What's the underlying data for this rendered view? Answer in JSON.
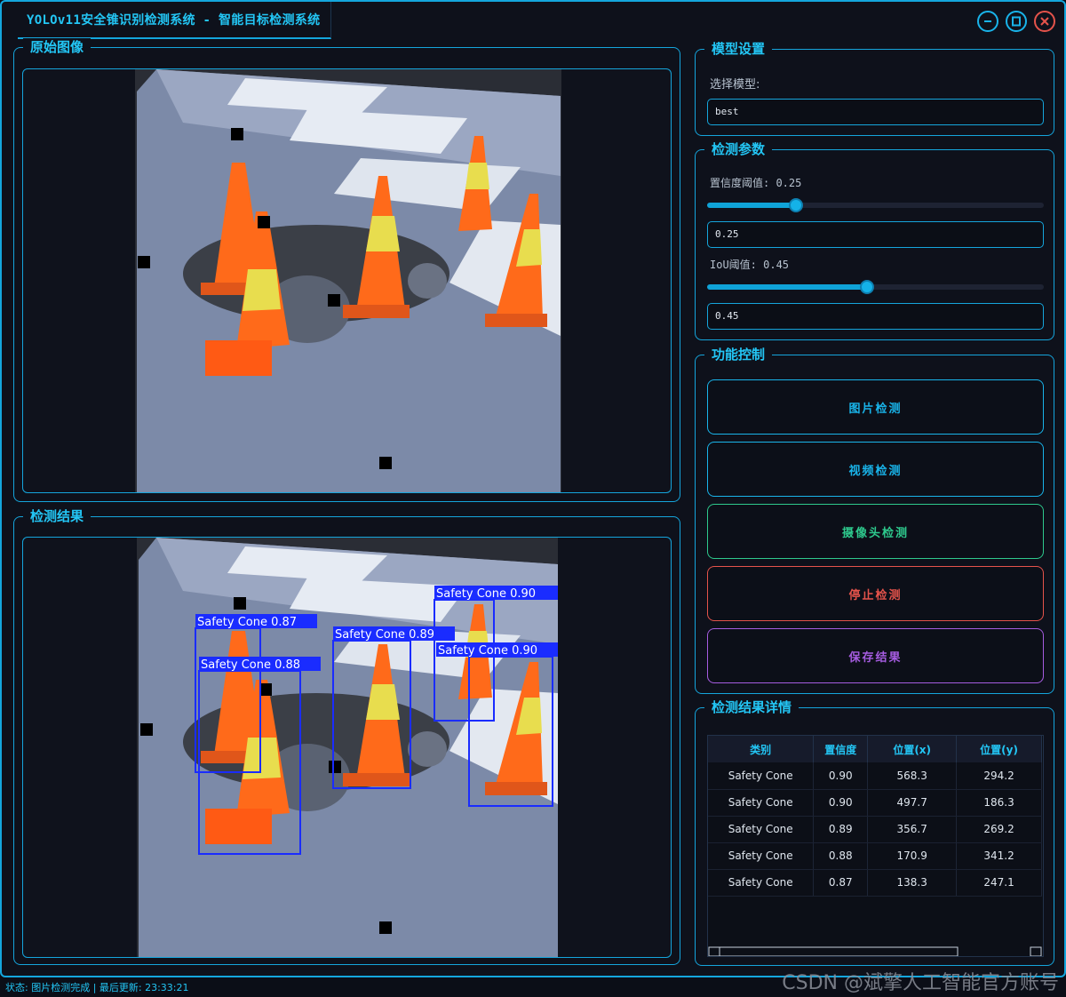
{
  "window": {
    "title": "YOLOv11安全锥识别检测系统 - 智能目标检测系统"
  },
  "panels": {
    "original_title": "原始图像",
    "result_title": "检测结果"
  },
  "model_settings": {
    "title": "模型设置",
    "select_label": "选择模型:",
    "model_value": "best"
  },
  "detect_params": {
    "title": "检测参数",
    "conf_label": "置信度阈值: 0.25",
    "conf_value": "0.25",
    "conf_level": 0.25,
    "iou_label": "IoU阈值: 0.45",
    "iou_value": "0.45",
    "iou_level": 0.45
  },
  "controls": {
    "title": "功能控制",
    "buttons": [
      {
        "label": "图片检测",
        "color": "#19b4ea"
      },
      {
        "label": "视频检测",
        "color": "#19b4ea"
      },
      {
        "label": "摄像头检测",
        "color": "#2ec98d"
      },
      {
        "label": "停止检测",
        "color": "#e5534b"
      },
      {
        "label": "保存结果",
        "color": "#a55ce0"
      }
    ]
  },
  "results": {
    "title": "检测结果详情",
    "columns": [
      "类别",
      "置信度",
      "位置(x)",
      "位置(y)"
    ],
    "rows": [
      [
        "Safety Cone",
        "0.90",
        "568.3",
        "294.2"
      ],
      [
        "Safety Cone",
        "0.90",
        "497.7",
        "186.3"
      ],
      [
        "Safety Cone",
        "0.89",
        "356.7",
        "269.2"
      ],
      [
        "Safety Cone",
        "0.88",
        "170.9",
        "341.2"
      ],
      [
        "Safety Cone",
        "0.87",
        "138.3",
        "247.1"
      ]
    ]
  },
  "detections": [
    {
      "label": "Safety Cone 0.87"
    },
    {
      "label": "Safety Cone 0.88"
    },
    {
      "label": "Safety Cone 0.89"
    },
    {
      "label": "Safety Cone 0.90"
    },
    {
      "label": "Safety Cone 0.90"
    }
  ],
  "status": {
    "text": "状态: 图片检测完成 | 最后更新: 23:33:21"
  },
  "watermark": "CSDN @斌擎人工智能官方账号",
  "colors": {
    "accent": "#14a6dd",
    "box": "#1a2cff"
  }
}
